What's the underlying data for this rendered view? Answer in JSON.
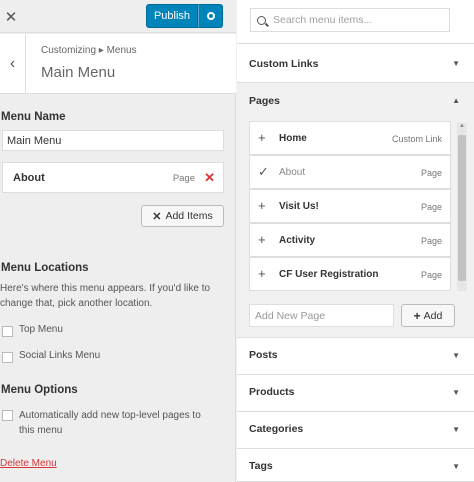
{
  "topbar": {
    "close_glyph": "✕",
    "publish_label": "Publish"
  },
  "header": {
    "back_glyph": "‹",
    "breadcrumb": "Customizing ▸ Menus",
    "title": "Main Menu"
  },
  "menu_name": {
    "label": "Menu Name",
    "value": "Main Menu"
  },
  "menu_items": [
    {
      "title": "About",
      "type": "Page",
      "remove_glyph": "✕"
    }
  ],
  "add_items_label": "Add Items",
  "add_items_glyph": "✕",
  "locations": {
    "heading": "Menu Locations",
    "description": "Here's where this menu appears. If you'd like to change that, pick another location.",
    "options": [
      "Top Menu",
      "Social Links Menu"
    ]
  },
  "options": {
    "heading": "Menu Options",
    "auto_add_label": "Automatically add new top-level pages to this menu"
  },
  "delete_label": "Delete Menu",
  "search": {
    "placeholder": "Search menu items..."
  },
  "sections": {
    "custom_links": "Custom Links",
    "pages": "Pages",
    "posts": "Posts",
    "products": "Products",
    "categories": "Categories",
    "tags": "Tags"
  },
  "pages_list": [
    {
      "icon": "+",
      "title": "Home",
      "type": "Custom Link",
      "added": false
    },
    {
      "icon": "✓",
      "title": "About",
      "type": "Page",
      "added": true
    },
    {
      "icon": "+",
      "title": "Visit Us!",
      "type": "Page",
      "added": false
    },
    {
      "icon": "+",
      "title": "Activity",
      "type": "Page",
      "added": false
    },
    {
      "icon": "+",
      "title": "CF User Registration",
      "type": "Page",
      "added": false
    }
  ],
  "new_page": {
    "placeholder": "Add New Page",
    "button_label": "Add",
    "button_glyph": "+"
  },
  "icons": {
    "collapsed": "▼",
    "expanded": "▲"
  },
  "colors": {
    "accent": "#0085ba",
    "danger": "#d63638"
  }
}
